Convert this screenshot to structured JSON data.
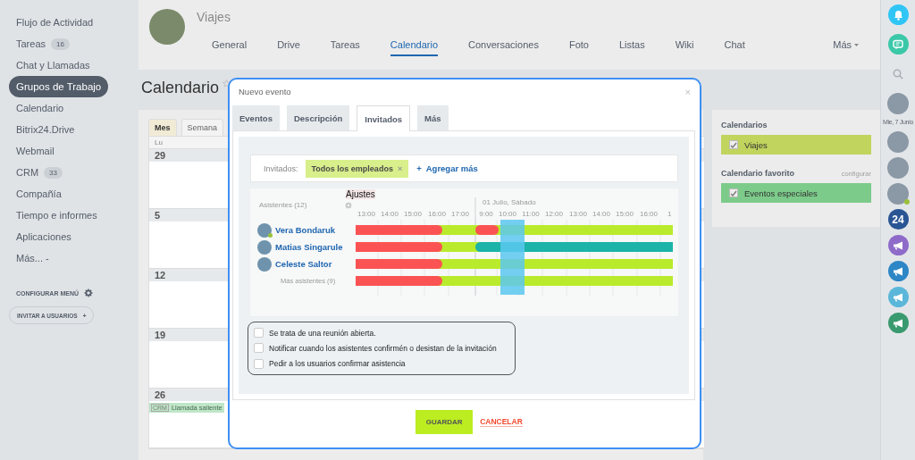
{
  "sidebar": {
    "items": [
      {
        "label": "Flujo de Actividad",
        "selected": false
      },
      {
        "label": "Tareas",
        "count": "16",
        "selected": false
      },
      {
        "label": "Chat y Llamadas",
        "selected": false
      },
      {
        "label": "Grupos de Trabajo",
        "selected": true
      },
      {
        "label": "Calendario",
        "selected": false
      },
      {
        "label": "Bitrix24.Drive",
        "selected": false
      },
      {
        "label": "Webmail",
        "selected": false
      },
      {
        "label": "CRM",
        "count": "33",
        "selected": false
      },
      {
        "label": "Compañía",
        "selected": false
      },
      {
        "label": "Tiempo e informes",
        "selected": false
      },
      {
        "label": "Aplicaciones",
        "selected": false
      },
      {
        "label": "Más... -",
        "selected": false
      }
    ],
    "configure": "CONFIGURAR MENÚ",
    "invite": "INVITAR A USUARIOS",
    "invite_icon": "+"
  },
  "group": {
    "title": "Viajes",
    "tabs": [
      {
        "label": "General",
        "selected": false
      },
      {
        "label": "Drive",
        "selected": false
      },
      {
        "label": "Tareas",
        "selected": false
      },
      {
        "label": "Calendario",
        "selected": true
      },
      {
        "label": "Conversaciones",
        "selected": false
      },
      {
        "label": "Foto",
        "selected": false
      },
      {
        "label": "Listas",
        "selected": false
      },
      {
        "label": "Wiki",
        "selected": false
      },
      {
        "label": "Chat",
        "selected": false
      }
    ],
    "more": "Más"
  },
  "page_title": "Calendario",
  "calendar": {
    "views": [
      {
        "label": "Mes",
        "selected": true
      },
      {
        "label": "Semana",
        "selected": false
      }
    ],
    "weekday": "Lu",
    "weeks": [
      {
        "day": "29"
      },
      {
        "day": "5"
      },
      {
        "day": "12"
      },
      {
        "day": "19"
      },
      {
        "day": "26",
        "events": [
          {
            "tag": "CRM",
            "title": "Llamada saliente"
          }
        ]
      }
    ]
  },
  "side_panel": {
    "calendars_title": "Calendarios",
    "calendars": [
      {
        "label": "Viajes",
        "checked": true,
        "color": "#c0d45e"
      }
    ],
    "favorites_title": "Calendario favorito",
    "configure": "configurar",
    "favorites": [
      {
        "label": "Eventos especiales",
        "checked": true,
        "color": "#7ccb8a"
      }
    ]
  },
  "right_bar": {
    "top_items": [
      {
        "kind": "bell",
        "color": "#2fc6f6"
      },
      {
        "kind": "chat",
        "color": "#3bc8a8"
      },
      {
        "kind": "search"
      },
      {
        "kind": "avatar",
        "online": false
      }
    ],
    "date": "Mie, 7 Junio",
    "items": [
      {
        "kind": "avatar",
        "online": false
      },
      {
        "kind": "avatar",
        "online": false
      },
      {
        "kind": "avatar",
        "online": true
      },
      {
        "kind": "counter",
        "label": "24",
        "color": "#2a5594"
      },
      {
        "kind": "megaphone",
        "color": "#8e6bc9"
      },
      {
        "kind": "megaphone",
        "color": "#2d86c6"
      },
      {
        "kind": "megaphone",
        "color": "#5bb7d9"
      },
      {
        "kind": "megaphone",
        "color": "#3a9a6f"
      }
    ]
  },
  "modal": {
    "title": "Nuevo evento",
    "close": "×",
    "tabs": [
      {
        "label": "Eventos",
        "selected": false
      },
      {
        "label": "Descripción",
        "selected": false
      },
      {
        "label": "Invitados",
        "selected": true
      },
      {
        "label": "Más",
        "selected": false
      }
    ],
    "invitees_label": "Invitados:",
    "invitee_tag": "Todos los empleados",
    "remove": "×",
    "add_icon": "+",
    "add_more": "Agregar más",
    "planner": {
      "settings": "Ajustes",
      "attendees_label": "Asistentes (12)",
      "date": "01 Julio, Sábado",
      "times_before": [
        "13:00",
        "14:00",
        "15:00",
        "16:00",
        "17:00"
      ],
      "times": [
        "9:00",
        "10:00",
        "11:00",
        "12:00",
        "13:00",
        "14:00",
        "15:00",
        "16:00",
        "1"
      ],
      "attendees": [
        {
          "name": "Vera Bondaruk",
          "online": true
        },
        {
          "name": "Matias Singarule",
          "online": false
        },
        {
          "name": "Celeste Saltor",
          "online": false
        }
      ],
      "more_attendees": "Más asistentes (9)"
    },
    "options": [
      {
        "label": "Se trata de una reunión abierta.",
        "checked": false
      },
      {
        "label": "Notificar cuando los asistentes confirmén o desistan de la invitación",
        "checked": false
      },
      {
        "label": "Pedir a los usuarios confirmar asistencia",
        "checked": false
      }
    ],
    "save": "GUARDAR",
    "cancel": "CANCELAR"
  }
}
